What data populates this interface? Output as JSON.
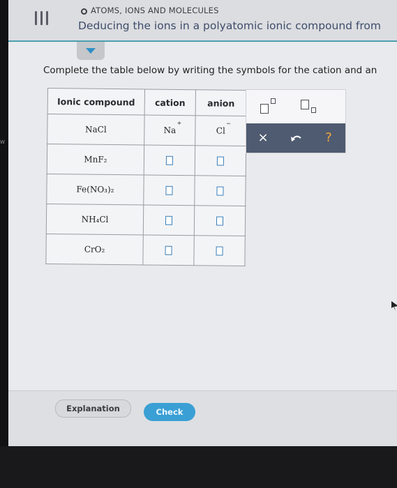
{
  "header": {
    "topic": "ATOMS, IONS AND MOLECULES",
    "title": "Deducing the ions in a polyatomic ionic compound from"
  },
  "instruction": "Complete the table below by writing the symbols for the cation and an",
  "table": {
    "headers": [
      "Ionic compound",
      "cation",
      "anion"
    ],
    "rows": [
      {
        "compound": "NaCl",
        "cation": "Na",
        "cation_charge": "+",
        "anion": "Cl",
        "anion_charge": "−"
      },
      {
        "compound": "MnF₂",
        "cation": "",
        "anion": ""
      },
      {
        "compound": "Fe(NO₃)₂",
        "cation": "",
        "anion": ""
      },
      {
        "compound": "NH₄Cl",
        "cation": "",
        "anion": ""
      },
      {
        "compound": "CrO₂",
        "cation": "",
        "anion": ""
      }
    ]
  },
  "tools": {
    "superscript": "superscript-template",
    "subscript": "subscript-template",
    "clear": "×",
    "undo": "undo-icon",
    "help": "?"
  },
  "footer": {
    "explanation": "Explanation",
    "check": "Check"
  },
  "side_letter": "W",
  "colors": {
    "accent": "#4a9fb0",
    "check_button": "#3a9fd4",
    "toolbar": "#4f5b70",
    "title": "#3e4d6b"
  }
}
